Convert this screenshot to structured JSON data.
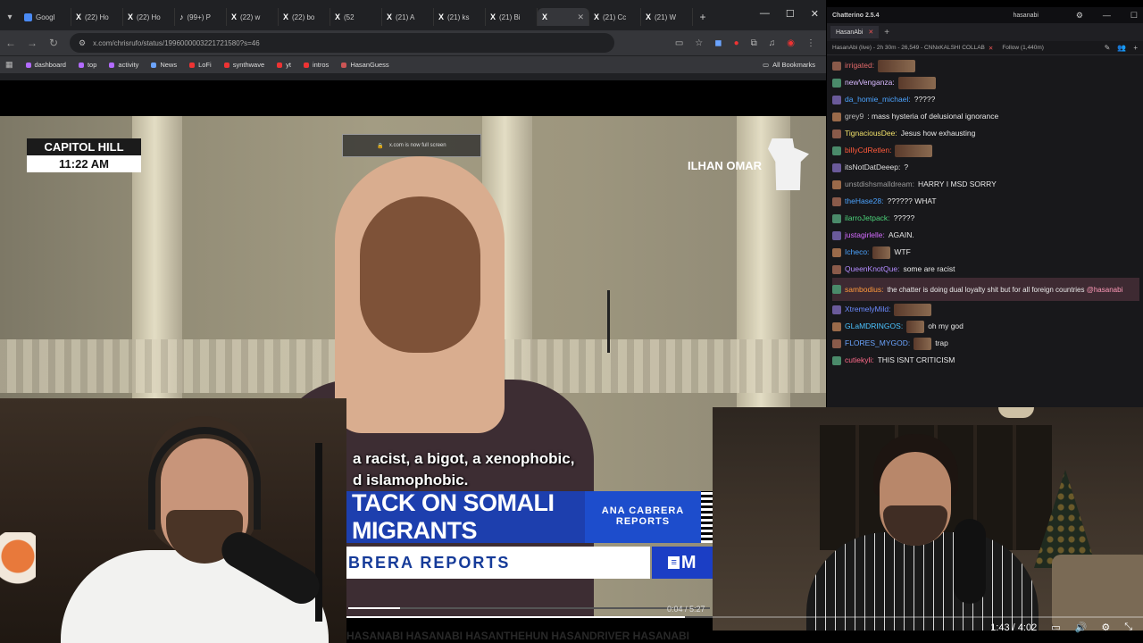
{
  "browser": {
    "tabs": [
      {
        "icon": "google",
        "label": "Googl"
      },
      {
        "icon": "x",
        "label": "(22) Ho"
      },
      {
        "icon": "x",
        "label": "(22) Ho"
      },
      {
        "icon": "tiktok",
        "label": "(99+) P"
      },
      {
        "icon": "x",
        "label": "(22) w"
      },
      {
        "icon": "x",
        "label": "(22) bo"
      },
      {
        "icon": "x",
        "label": "(52"
      },
      {
        "icon": "x",
        "label": "(21) A"
      },
      {
        "icon": "x",
        "label": "(21) ks"
      },
      {
        "icon": "x",
        "label": "(21) Bi"
      },
      {
        "icon": "x",
        "label": ""
      },
      {
        "icon": "x",
        "label": "(21) Cc"
      },
      {
        "icon": "x",
        "label": "(21) W"
      }
    ],
    "url": "x.com/chrisrufo/status/1996000003221721580?s=46",
    "bookmarks": [
      {
        "label": "dashboard",
        "color": "#b36bff"
      },
      {
        "label": "top",
        "color": "#b36bff"
      },
      {
        "label": "activity",
        "color": "#b36bff"
      },
      {
        "label": "News",
        "color": "#6ba4ff"
      },
      {
        "label": "LoFi",
        "color": "#e33"
      },
      {
        "label": "synthwave",
        "color": "#e33"
      },
      {
        "label": "yt",
        "color": "#e33"
      },
      {
        "label": "intros",
        "color": "#e33"
      },
      {
        "label": "HasanGuess",
        "color": "#c55"
      }
    ],
    "all_bookmarks": "All Bookmarks"
  },
  "video": {
    "location": "CAPITOL HILL",
    "time": "11:22 AM",
    "fullscreen_note": "x.com is now full screen",
    "speaker": "ILHAN OMAR",
    "caption_line1": "a racist, a bigot, a xenophobic,",
    "caption_line2": "d islamophobic.",
    "lower_third": "TACK ON SOMALI MIGRANTS",
    "show_name": "ANA CABRERA REPORTS",
    "show_strip": "BRERA REPORTS",
    "network_logo": "M",
    "elapsed": "0:04",
    "duration": "5:27",
    "progress": 0.012
  },
  "chat": {
    "app_title": "Chatterino 2.5.4",
    "username": "hasanabi",
    "tab_label": "HasanAbi",
    "header": "HasanAbi (live) - 2h 30m - 26,549 - CNNxKALSHI COLLAB",
    "follow": "Follow (1,440m)",
    "messages": [
      {
        "user": "irrigated:",
        "color": "#e36a6a",
        "text": "",
        "emote": true
      },
      {
        "user": "newVenganza:",
        "color": "#d8b9ff",
        "text": "",
        "emote": true
      },
      {
        "user": "da_homie_michael:",
        "color": "#4ba3ff",
        "text": "?????",
        "emote": false
      },
      {
        "user": "grey9",
        "color": "#bbbbbb",
        "text": ": mass hysteria of delusional ignorance",
        "emote": false
      },
      {
        "user": "TignaciousDee:",
        "color": "#f0e06a",
        "text": "Jesus how exhausting",
        "emote": false
      },
      {
        "user": "billyCdRetlen:",
        "color": "#ff5a3c",
        "text": "",
        "emote": true
      },
      {
        "user": "itsNotDatDeeep:",
        "color": "#dddddd",
        "text": "?",
        "emote": false
      },
      {
        "user": "unstdishsmalldream:",
        "color": "#9a9a9a",
        "text": "HARRY I MSD SORRY",
        "emote": false
      },
      {
        "user": "theHase28:",
        "color": "#4ba3ff",
        "text": "?????? WHAT",
        "emote": false
      },
      {
        "user": "ilarroJetpack:",
        "color": "#4bd37a",
        "text": "?????",
        "emote": false
      },
      {
        "user": "justagirlelle:",
        "color": "#d46bff",
        "text": "AGAIN.",
        "emote": false
      },
      {
        "user": "Icheco:",
        "color": "#4ba3ff",
        "text": "WTF",
        "emote": true
      },
      {
        "user": "QueenKnotQue:",
        "color": "#b38bff",
        "text": "some are racist",
        "emote": false
      },
      {
        "user": "sambodius:",
        "color": "#ff9a3c",
        "text": "the chatter is doing dual loyalty shit but for all foreign countries",
        "mention": "@hasanabi",
        "emote": false
      },
      {
        "user": "XtremelyMild:",
        "color": "#6b8aff",
        "text": "",
        "emote": true
      },
      {
        "user": "GLaMDRINGOS:",
        "color": "#4bc3ff",
        "text": "oh my god",
        "emote": true
      },
      {
        "user": "FLORES_MYGOD:",
        "color": "#6ba4ff",
        "text": "trap",
        "emote": true
      },
      {
        "user": "cutiekyli:",
        "color": "#ff6a8a",
        "text": "THIS ISNT CRITICISM",
        "emote": false
      }
    ]
  },
  "player": {
    "current": "1:43",
    "duration": "4:02",
    "progress": 0.425
  },
  "tag_strip": "HASANABI  HASANABI  HASANTHEHUN  HASANDRIVER  HASANABI"
}
